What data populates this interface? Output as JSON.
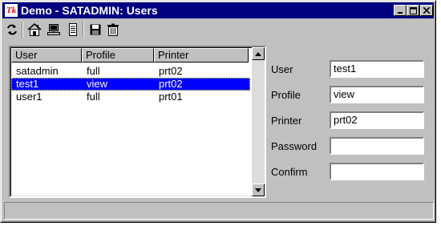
{
  "window": {
    "app_icon_text": "Tk",
    "title": "Demo - SATADMIN: Users",
    "controls": [
      "minimize",
      "maximize",
      "close"
    ]
  },
  "toolbar": {
    "tools": [
      {
        "icon": "refresh-icon"
      },
      {
        "icon": "home-icon"
      },
      {
        "icon": "computer-icon"
      },
      {
        "icon": "list-icon"
      },
      {
        "icon": "save-icon"
      },
      {
        "icon": "trash-icon"
      }
    ]
  },
  "users_list": {
    "columns": [
      "User",
      "Profile",
      "Printer"
    ],
    "rows": [
      {
        "user": "satadmin",
        "profile": "full",
        "printer": "prt02",
        "selected": false
      },
      {
        "user": "test1",
        "profile": "view",
        "printer": "prt02",
        "selected": true
      },
      {
        "user": "user1",
        "profile": "full",
        "printer": "prt01",
        "selected": false
      }
    ]
  },
  "form": {
    "user_label": "User",
    "user_value": "test1",
    "profile_label": "Profile",
    "profile_value": "view",
    "printer_label": "Printer",
    "printer_value": "prt02",
    "password_label": "Password",
    "password_value": "",
    "confirm_label": "Confirm",
    "confirm_value": ""
  },
  "colors": {
    "titlebar": "#000080",
    "selection": "#0000ff",
    "window_bg": "#c0c0c0"
  },
  "statusbar": {
    "text": ""
  }
}
